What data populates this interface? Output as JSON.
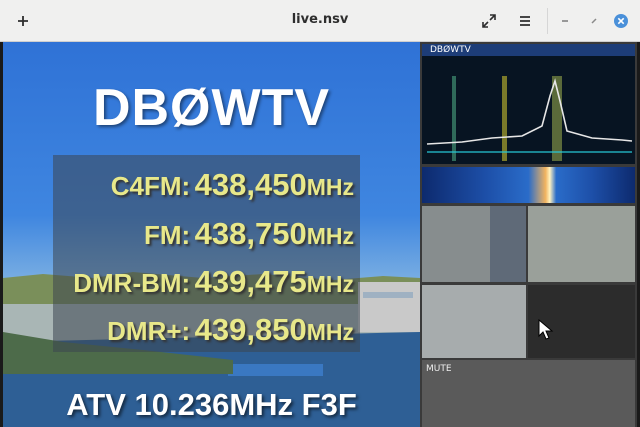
{
  "window": {
    "title": "live.nsv",
    "new_tab_icon": "plus-icon",
    "fullscreen_icon": "fullscreen-icon",
    "menu_icon": "hamburger-menu-icon",
    "minimize_icon": "minimize-icon",
    "maximize_icon": "maximize-icon",
    "close_icon": "close-icon"
  },
  "video": {
    "callsign": "DBØWTV",
    "frequencies": [
      {
        "mode": "C4FM:",
        "value": "438,450",
        "unit": "MHz"
      },
      {
        "mode": "FM:",
        "value": "438,750",
        "unit": "MHz"
      },
      {
        "mode": "DMR-BM:",
        "value": "439,475",
        "unit": "MHz"
      },
      {
        "mode": "DMR+:",
        "value": "439,850",
        "unit": "MHz"
      }
    ],
    "atv_line": "ATV 10.236MHz F3F",
    "side": {
      "spectrum_label": "DBØWTV",
      "mute_label": "MUTE"
    }
  },
  "colors": {
    "titlebar": "#f0f0ef",
    "close_button": "#4a90d9",
    "freq_text": "#e8e88a"
  }
}
